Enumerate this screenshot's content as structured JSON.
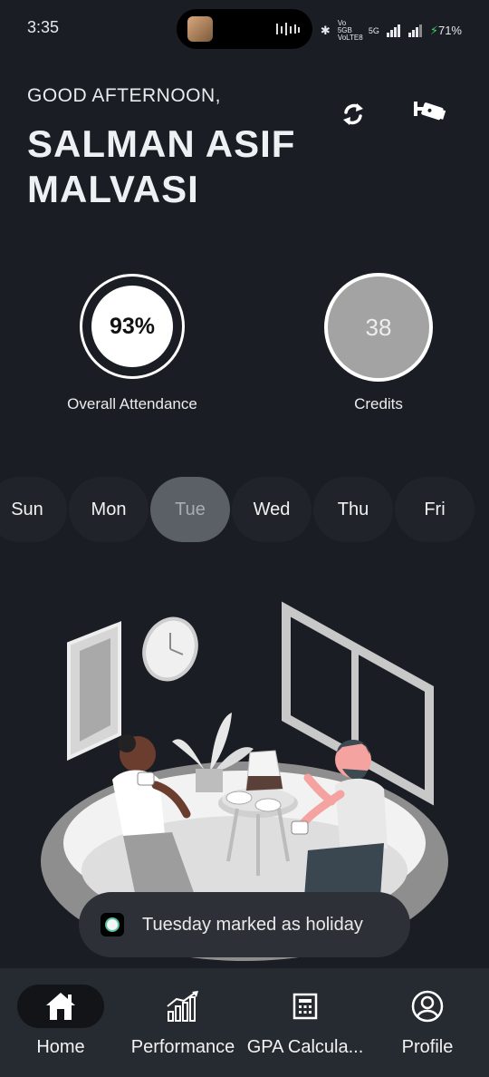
{
  "status_bar": {
    "time": "3:35",
    "network": "Vo 5GB VoLTE8",
    "signal": "5G",
    "battery": "71%"
  },
  "header": {
    "greeting": "GOOD AFTERNOON,",
    "name": "SALMAN ASIF MALVASI",
    "refresh_icon": "refresh-icon",
    "camera_icon": "cctv-camera-icon"
  },
  "stats": {
    "attendance_value": "93%",
    "attendance_label": "Overall Attendance",
    "credits_value": "38",
    "credits_label": "Credits"
  },
  "days": {
    "items": [
      "Sun",
      "Mon",
      "Tue",
      "Wed",
      "Thu",
      "Fri"
    ],
    "selected": "Tue"
  },
  "toast": {
    "message": "Tuesday marked as holiday"
  },
  "nav": {
    "items": [
      {
        "label": "Home",
        "icon": "home-icon"
      },
      {
        "label": "Performance",
        "icon": "bar-chart-icon"
      },
      {
        "label": "GPA Calcula...",
        "icon": "calculator-icon"
      },
      {
        "label": "Profile",
        "icon": "profile-icon"
      }
    ],
    "active": "Home"
  },
  "colors": {
    "background": "#1a1e24",
    "chip": "#20242a",
    "chip_active": "#5b5f66",
    "credits_fill": "#a3a3a3",
    "nav_bar": "#262a31",
    "toast": "#2d3036"
  }
}
